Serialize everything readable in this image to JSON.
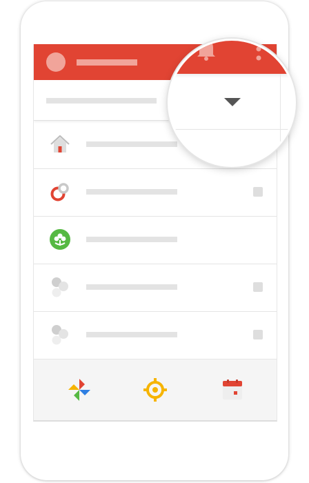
{
  "app": {
    "appbar_color": "#e14433",
    "icons": {
      "home": "home-icon",
      "rings": "rings-icon",
      "green_circle": "clover-icon",
      "gray_group": "gray-group-icon",
      "photos": "pinwheel-icon",
      "target": "target-icon",
      "calendar": "calendar-icon",
      "bell": "bell-icon",
      "more": "more-vert-icon",
      "dropdown": "dropdown-arrow-icon"
    },
    "list": {
      "rows": [
        {
          "icon": "home-icon",
          "checkbox": false
        },
        {
          "icon": "rings-icon",
          "checkbox": true
        },
        {
          "icon": "clover-icon",
          "checkbox": false
        },
        {
          "icon": "gray-group-icon",
          "checkbox": true
        },
        {
          "icon": "gray-group-icon",
          "checkbox": true
        }
      ]
    },
    "colors": {
      "red": "#e14433",
      "green": "#56b943",
      "yellow": "#f6b400",
      "gray": "#cfcfcf"
    }
  }
}
